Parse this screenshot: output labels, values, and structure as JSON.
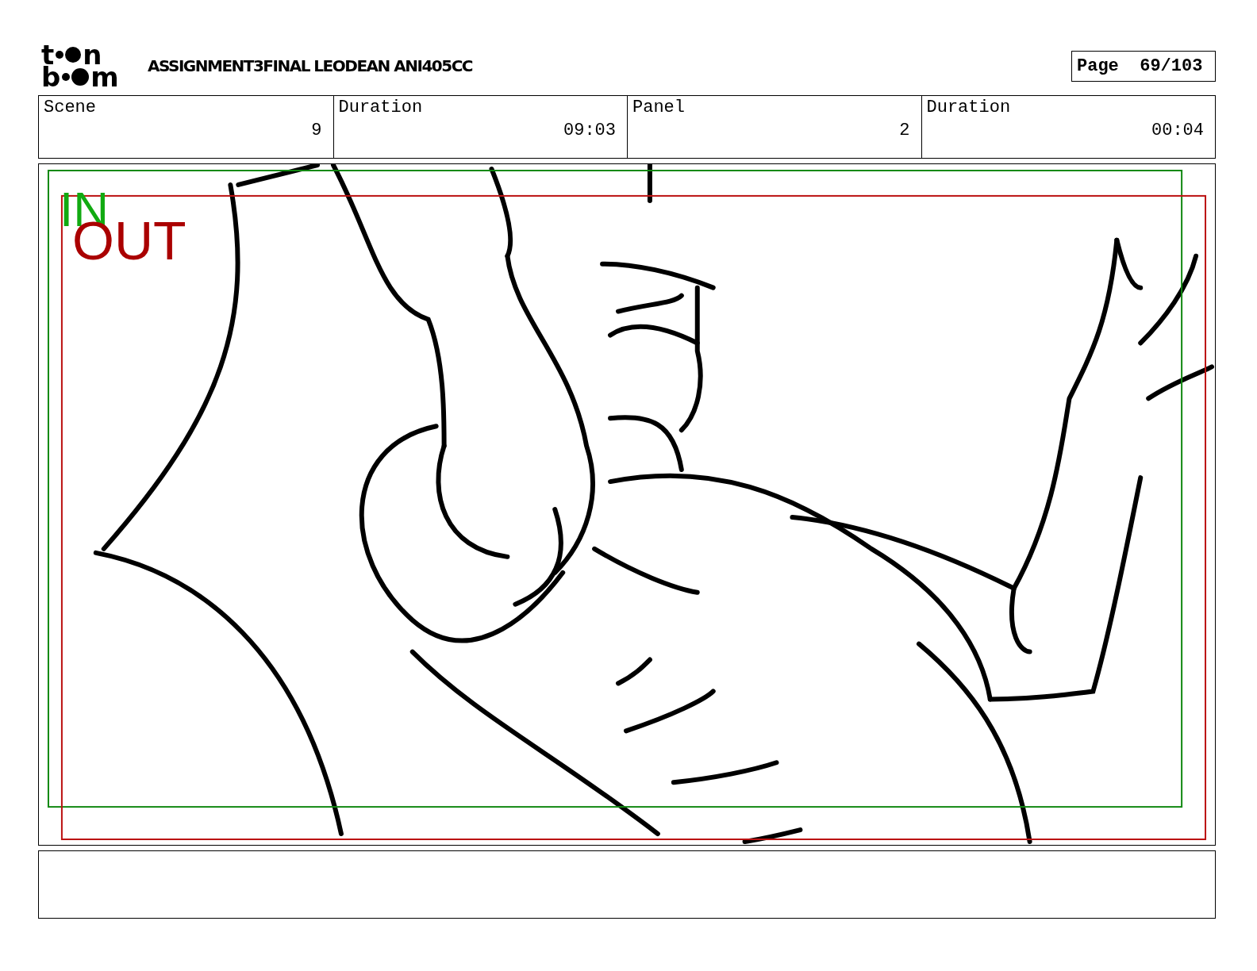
{
  "header": {
    "logo": [
      {
        "lead": "t",
        "tail": "n"
      },
      {
        "lead": "b",
        "tail": "m"
      }
    ],
    "title": "ASSIGNMENT3FINAL LEODEAN ANI405CC",
    "page_label": "Page",
    "page_number": "69/103"
  },
  "info": [
    {
      "label": "Scene",
      "value": "9"
    },
    {
      "label": "Duration",
      "value": "09:03"
    },
    {
      "label": "Panel",
      "value": "2"
    },
    {
      "label": "Duration",
      "value": "00:04"
    }
  ],
  "panel": {
    "in_label": "IN",
    "out_label": "OUT"
  }
}
